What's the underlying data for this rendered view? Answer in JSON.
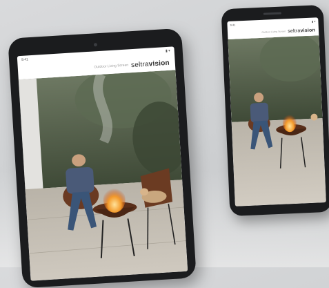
{
  "tablet": {
    "status_left": "9:41",
    "status_right": "▮ ▾",
    "tagline": "Outdoor Living Screen",
    "logo_light": "seltra",
    "logo_bold": "vision"
  },
  "phone": {
    "status_left": "9:41",
    "status_right": "▮ ▾",
    "tagline": "Outdoor Living Screen",
    "logo_light": "seltra",
    "logo_bold": "vision"
  },
  "colors": {
    "device_frame": "#1b1c1e",
    "background": "#d2d4d6",
    "fire": "#f39a2b",
    "foliage": "#4f5b45"
  }
}
